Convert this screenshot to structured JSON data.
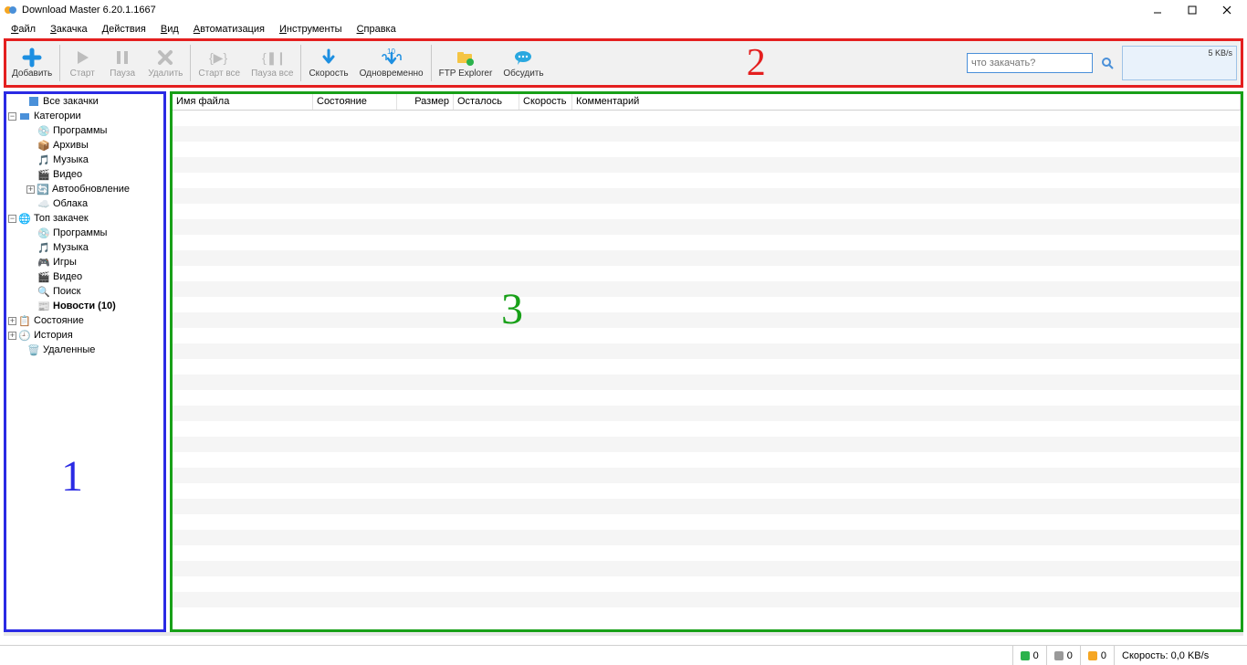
{
  "window": {
    "title": "Download Master 6.20.1.1667"
  },
  "menu": [
    "Файл",
    "Закачка",
    "Действия",
    "Вид",
    "Автоматизация",
    "Инструменты",
    "Справка"
  ],
  "toolbar": {
    "add": "Добавить",
    "start": "Старт",
    "pause": "Пауза",
    "delete": "Удалить",
    "start_all": "Старт все",
    "pause_all": "Пауза все",
    "speed": "Скорость",
    "concurrent": "Одновременно",
    "concurrent_count": "10",
    "ftp": "FTP Explorer",
    "discuss": "Обсудить",
    "search_placeholder": "что закачать?",
    "speedbox": "5 KB/s"
  },
  "annotations": {
    "sidebar": "1",
    "toolbar": "2",
    "main": "3"
  },
  "tree": {
    "all": "Все закачки",
    "categories": "Категории",
    "cat_programs": "Программы",
    "cat_archives": "Архивы",
    "cat_music": "Музыка",
    "cat_video": "Видео",
    "cat_autoupdate": "Автообновление",
    "cat_clouds": "Облака",
    "top": "Топ закачек",
    "top_programs": "Программы",
    "top_music": "Музыка",
    "top_games": "Игры",
    "top_video": "Видео",
    "top_search": "Поиск",
    "top_news": "Новости (10)",
    "state": "Состояние",
    "history": "История",
    "deleted": "Удаленные"
  },
  "columns": {
    "name": "Имя файла",
    "state": "Состояние",
    "size": "Размер",
    "remaining": "Осталось",
    "speed": "Скорость",
    "comment": "Комментарий"
  },
  "status": {
    "green": "0",
    "gray": "0",
    "orange": "0",
    "speed": "Скорость: 0,0 KB/s"
  }
}
